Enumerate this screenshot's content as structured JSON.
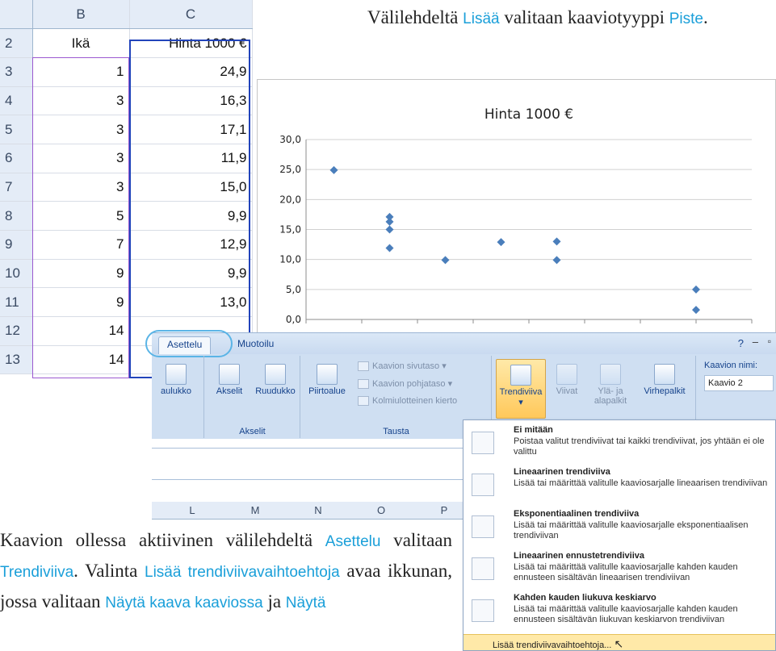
{
  "top_text": {
    "part1": "Välilehdeltä ",
    "hl1": "Lisää",
    "part2": " valitaan kaaviotyyppi ",
    "hl2": "Piste",
    "part3": "."
  },
  "spreadsheet": {
    "col_headers": [
      "B",
      "C"
    ],
    "rows": [
      {
        "num": "2",
        "b": "Ikä",
        "c": "Hinta 1000 €"
      },
      {
        "num": "3",
        "b": "1",
        "c": "24,9"
      },
      {
        "num": "4",
        "b": "3",
        "c": "16,3"
      },
      {
        "num": "5",
        "b": "3",
        "c": "17,1"
      },
      {
        "num": "6",
        "b": "3",
        "c": "11,9"
      },
      {
        "num": "7",
        "b": "3",
        "c": "15,0"
      },
      {
        "num": "8",
        "b": "5",
        "c": "9,9"
      },
      {
        "num": "9",
        "b": "7",
        "c": "12,9"
      },
      {
        "num": "10",
        "b": "9",
        "c": "9,9"
      },
      {
        "num": "11",
        "b": "9",
        "c": "13,0"
      },
      {
        "num": "12",
        "b": "14",
        "c": ""
      },
      {
        "num": "13",
        "b": "14",
        "c": ""
      }
    ]
  },
  "chart_data": {
    "type": "scatter",
    "title": "Hinta 1000 €",
    "y_ticks": [
      "30,0",
      "25,0",
      "20,0",
      "15,0",
      "10,0",
      "5,0",
      "0,0"
    ],
    "ylim": [
      0,
      30
    ],
    "xlim": [
      0,
      16
    ],
    "grid": true,
    "color": "#4a7ebb",
    "points": [
      {
        "x": 1,
        "y": 24.9
      },
      {
        "x": 3,
        "y": 16.3
      },
      {
        "x": 3,
        "y": 17.1
      },
      {
        "x": 3,
        "y": 11.9
      },
      {
        "x": 3,
        "y": 15.0
      },
      {
        "x": 5,
        "y": 9.9
      },
      {
        "x": 7,
        "y": 12.9
      },
      {
        "x": 9,
        "y": 9.9
      },
      {
        "x": 9,
        "y": 13.0
      },
      {
        "x": 14,
        "y": 5.0
      },
      {
        "x": 14,
        "y": 1.6
      }
    ]
  },
  "ribbon": {
    "tabs": [
      "Asettelu",
      "Muotoilu"
    ],
    "groups": {
      "akselit": {
        "label": "Akselit",
        "buttons": [
          "Akselit",
          "Ruudukko"
        ]
      },
      "tausta": {
        "label": "Tausta",
        "piirtoalue": "Piirtoalue",
        "small": [
          "Kaavion sivutaso",
          "Kaavion pohjataso",
          "Kolmiulotteinen kierto"
        ]
      },
      "analyysi": {
        "buttons": [
          "Trendiviiva",
          "Viivat",
          "Ylä- ja alapalkit",
          "Virhepalkit"
        ]
      },
      "partial_label": "aulukko",
      "name_label": "Kaavion nimi:",
      "name_value": "Kaavio 2"
    }
  },
  "grid_columns": [
    "L",
    "M",
    "N",
    "O",
    "P"
  ],
  "dropdown": {
    "items": [
      {
        "title": "Ei mitään",
        "desc": "Poistaa valitut trendiviivat tai kaikki trendiviivat, jos yhtään ei ole valittu"
      },
      {
        "title": "Lineaarinen trendiviiva",
        "desc": "Lisää tai määrittää valitulle kaaviosarjalle lineaarisen trendiviivan"
      },
      {
        "title": "Eksponentiaalinen trendiviiva",
        "desc": "Lisää tai määrittää valitulle kaaviosarjalle eksponentiaalisen trendiviivan"
      },
      {
        "title": "Lineaarinen ennustetrendiviiva",
        "desc": "Lisää tai määrittää valitulle kaaviosarjalle kahden kauden ennusteen sisältävän lineaarisen trendiviivan"
      },
      {
        "title": "Kahden kauden liukuva keskiarvo",
        "desc": "Lisää tai määrittää valitulle kaaviosarjalle kahden kauden ennusteen sisältävän liukuvan keskiarvon trendiviivan"
      }
    ],
    "more": "Lisää trendiviivavaihtoehtoja..."
  },
  "bottom_text": {
    "p1": "Kaavion ollessa aktiivinen välilehdeltä ",
    "hl1": "Asettelu",
    "p2": " valitaan ",
    "hl2": "Trendiviiva",
    "p3": ". Valinta ",
    "hl3": "Lisää trendiviivavaihtoehtoja",
    "p4": " avaa ikkunan, jossa valitaan ",
    "hl4": "Näytä kaava kaaviossa",
    "p5": " ja ",
    "hl5": "Näytä"
  }
}
